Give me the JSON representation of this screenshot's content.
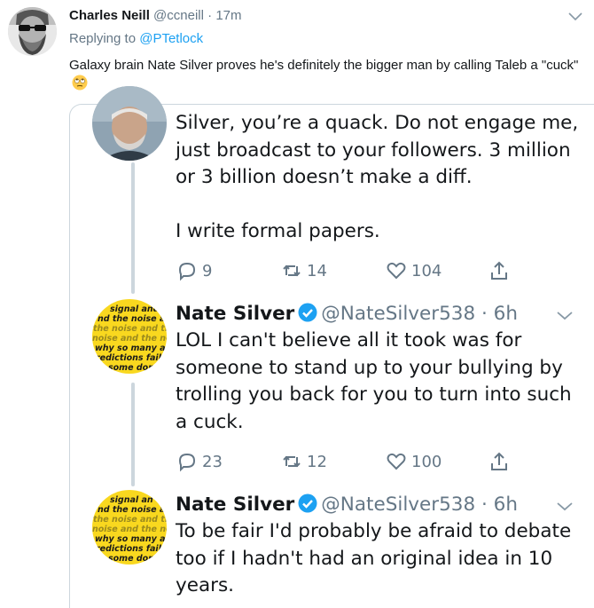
{
  "outer_tweet": {
    "author_name": "Charles Neill",
    "handle": "@ccneill",
    "separator": "·",
    "time": "17m",
    "replying_prefix": "Replying to",
    "replying_to": "@PTetlock",
    "text": "Galaxy brain Nate Silver proves he's definitely the bigger man by calling Taleb a \"cuck\"",
    "emoji": "face-with-rolling-eyes-icon"
  },
  "thread": [
    {
      "text_lines": [
        "Silver, you’re a quack. Do not engage me,",
        "just broadcast to your followers. 3 million",
        "or 3 billion doesn’t make a diff.",
        "",
        "I write formal papers."
      ],
      "replies": "9",
      "retweets": "14",
      "likes": "104"
    },
    {
      "author_name": "Nate Silver",
      "handle": "@NateSilver538",
      "separator": "·",
      "time": "6h",
      "avatar_text": [
        "signal and",
        "nd the noise a",
        "the noise and th",
        "noise and the noi",
        "why so many an",
        "redictions fail",
        "some don'"
      ],
      "text_lines": [
        "LOL I can't believe all it took was for",
        "someone to stand up to your bullying by",
        "trolling you back for you to turn into such",
        "a cuck."
      ],
      "replies": "23",
      "retweets": "12",
      "likes": "100"
    },
    {
      "author_name": "Nate Silver",
      "handle": "@NateSilver538",
      "separator": "·",
      "time": "6h",
      "avatar_text": [
        "signal an",
        "nd the noise a",
        "the noise and th",
        "noise and the noi",
        "why so many an",
        "redictions fail",
        "some don'"
      ],
      "text_lines": [
        "To be fair I'd probably be afraid to debate",
        "too if I hadn't had an original idea in 10",
        "years."
      ]
    }
  ],
  "colors": {
    "link": "#1da1f2",
    "muted": "#657786",
    "border": "#ccd6dd",
    "avatar_yellow": "#f9d81f",
    "verified": "#1da1f2"
  }
}
